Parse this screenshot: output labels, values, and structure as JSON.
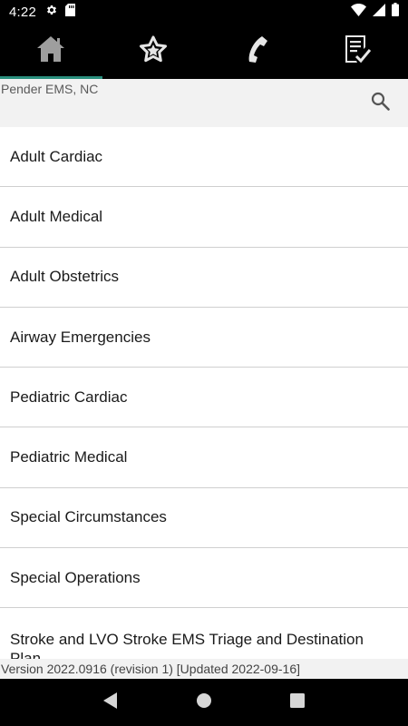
{
  "status_bar": {
    "time": "4:22",
    "left_icons": [
      "gear-icon",
      "sd-card-icon"
    ],
    "right_icons": [
      "wifi-icon",
      "signal-icon",
      "battery-icon"
    ]
  },
  "tabs": [
    {
      "icon": "home-icon",
      "active": true
    },
    {
      "icon": "star-icon",
      "active": false
    },
    {
      "icon": "phone-icon",
      "active": false
    },
    {
      "icon": "checklist-icon",
      "active": false
    }
  ],
  "agency": "Pender EMS, NC",
  "search_icon": "search-icon",
  "protocol_list": [
    {
      "label": "Adult Cardiac"
    },
    {
      "label": "Adult Medical"
    },
    {
      "label": "Adult Obstetrics"
    },
    {
      "label": "Airway Emergencies"
    },
    {
      "label": "Pediatric Cardiac"
    },
    {
      "label": "Pediatric Medical"
    },
    {
      "label": "Special Circumstances"
    },
    {
      "label": "Special Operations"
    },
    {
      "label": "Stroke and LVO Stroke EMS Triage and Destination Plan"
    }
  ],
  "version": "Version 2022.0916 (revision 1) [Updated 2022-09-16]",
  "nav": [
    "back-icon",
    "home-circle-icon",
    "recents-icon"
  ],
  "colors": {
    "accent": "#2a8f7d",
    "bar": "#000000",
    "tab_icon": "#e6e6e6",
    "home_icon": "#9e9e9e"
  }
}
